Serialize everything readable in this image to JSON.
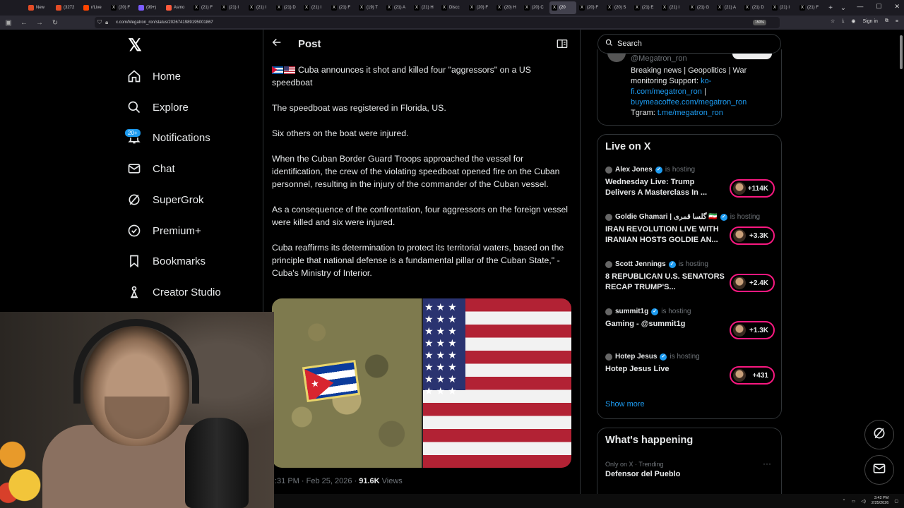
{
  "browser": {
    "tabs": [
      {
        "label": "New",
        "color": "#e34c26",
        "glyph": ""
      },
      {
        "label": "(3272",
        "color": "#e34c26",
        "glyph": ""
      },
      {
        "label": "r/Live",
        "color": "#ff4500",
        "glyph": ""
      },
      {
        "label": "(20) F",
        "color": "#000000",
        "glyph": "X"
      },
      {
        "label": "(99+)",
        "color": "#7b5cff",
        "glyph": ""
      },
      {
        "label": "Asmo",
        "color": "#ff5a3c",
        "glyph": ""
      },
      {
        "label": "(21) F",
        "color": "#000000",
        "glyph": "X"
      },
      {
        "label": "(21) I",
        "color": "#000000",
        "glyph": "X"
      },
      {
        "label": "(21) I",
        "color": "#000000",
        "glyph": "X"
      },
      {
        "label": "(21) D",
        "color": "#000000",
        "glyph": "X"
      },
      {
        "label": "(21) I",
        "color": "#000000",
        "glyph": "X"
      },
      {
        "label": "(21) F",
        "color": "#000000",
        "glyph": "X"
      },
      {
        "label": "(19) T",
        "color": "#000000",
        "glyph": "X"
      },
      {
        "label": "(21) A",
        "color": "#000000",
        "glyph": "X"
      },
      {
        "label": "(21) H",
        "color": "#000000",
        "glyph": "X"
      },
      {
        "label": "Discc",
        "color": "#000000",
        "glyph": "X"
      },
      {
        "label": "(20) F",
        "color": "#000000",
        "glyph": "X"
      },
      {
        "label": "(20) H",
        "color": "#000000",
        "glyph": "X"
      },
      {
        "label": "(20) C",
        "color": "#000000",
        "glyph": "X"
      },
      {
        "label": "(20",
        "color": "#000000",
        "glyph": "X",
        "active": true
      },
      {
        "label": "(20) F",
        "color": "#000000",
        "glyph": "X"
      },
      {
        "label": "(20) S",
        "color": "#000000",
        "glyph": "X"
      },
      {
        "label": "(21) E",
        "color": "#000000",
        "glyph": "X"
      },
      {
        "label": "(21) I",
        "color": "#000000",
        "glyph": "X"
      },
      {
        "label": "(21) G",
        "color": "#000000",
        "glyph": "X"
      },
      {
        "label": "(21) A",
        "color": "#000000",
        "glyph": "X"
      },
      {
        "label": "(21) D",
        "color": "#000000",
        "glyph": "X"
      },
      {
        "label": "(21) I",
        "color": "#000000",
        "glyph": "X"
      },
      {
        "label": "(21) F",
        "color": "#000000",
        "glyph": "X"
      }
    ],
    "url": "x.com/Megatron_ron/status/2026741989195001867",
    "zoom": "150%",
    "sign_in": "Sign in"
  },
  "nav": {
    "logo": "𝕏",
    "items": [
      {
        "label": "Home",
        "icon": "home-icon"
      },
      {
        "label": "Explore",
        "icon": "search-icon"
      },
      {
        "label": "Notifications",
        "icon": "bell-icon"
      },
      {
        "label": "Chat",
        "icon": "mail-icon"
      },
      {
        "label": "SuperGrok",
        "icon": "grok-icon"
      },
      {
        "label": "Premium+",
        "icon": "premium-icon"
      },
      {
        "label": "Bookmarks",
        "icon": "bookmark-icon"
      },
      {
        "label": "Creator Studio",
        "icon": "creator-icon"
      }
    ],
    "notifications_badge": "20+"
  },
  "post": {
    "header_title": "Post",
    "paragraphs": [
      "Cuba announces it shot and killed four \"aggressors\" on a US speedboat",
      "The speedboat was registered in Florida, US.",
      "Six others on the boat were injured.",
      "When the Cuban Border Guard Troops approached the vessel for identification, the crew of the violating speedboat opened fire on the Cuban personnel, resulting in the injury of the commander of the Cuban vessel.",
      "As a consequence of the confrontation, four aggressors on the foreign vessel were killed and six were injured.",
      "Cuba reaffirms its determination to protect its territorial waters, based on the principle that national defense is a fundamental pillar of the Cuban State,\" - Cuba's Ministry of Interior."
    ],
    "meta_time": ":31 PM · Feb 25, 2026 · ",
    "views_count": "91.6K",
    "views_label": " Views"
  },
  "search": {
    "placeholder": "Search"
  },
  "bio": {
    "handle": "@Megatron_ron",
    "text_plain": "Breaking news | Geopolitics | War monitoring Support: ",
    "link1": "ko-fi.com/megatron_ron",
    "sep": " | ",
    "link2": "buymeacoffee.com/megatron_ron",
    "tgram": " Tgram: ",
    "link3": "t.me/megatron_ron"
  },
  "live": {
    "title": "Live on X",
    "hosting_label": "is hosting",
    "items": [
      {
        "host": "Alex Jones",
        "title": "Wednesday Live: Trump Delivers A Masterclass In ...",
        "count": "+114K"
      },
      {
        "host": "Goldie Ghamari | گلسا قمری 🇮🇷",
        "title": "IRAN REVOLUTION LIVE WITH IRANIAN HOSTS GOLDIE AN...",
        "count": "+3.3K"
      },
      {
        "host": "Scott Jennings",
        "title": "8 REPUBLICAN U.S. SENATORS RECAP TRUMP'S...",
        "count": "+2.4K"
      },
      {
        "host": "summit1g",
        "title": "Gaming - @summit1g",
        "count": "+1.3K"
      },
      {
        "host": "Hotep Jesus",
        "title": "Hotep Jesus Live",
        "count": "+431"
      }
    ],
    "show_more": "Show more"
  },
  "happening": {
    "title": "What's happening",
    "trend_meta": "Only on X · Trending",
    "trend_name": "Defensor del Pueblo",
    "more": "···"
  },
  "taskbar": {
    "time": "3:42 PM",
    "date": "2/25/2026"
  },
  "colors": {
    "accent": "#1d9bf0",
    "live_ring": "#f91880",
    "background": "#000000",
    "border": "#2f3336"
  }
}
